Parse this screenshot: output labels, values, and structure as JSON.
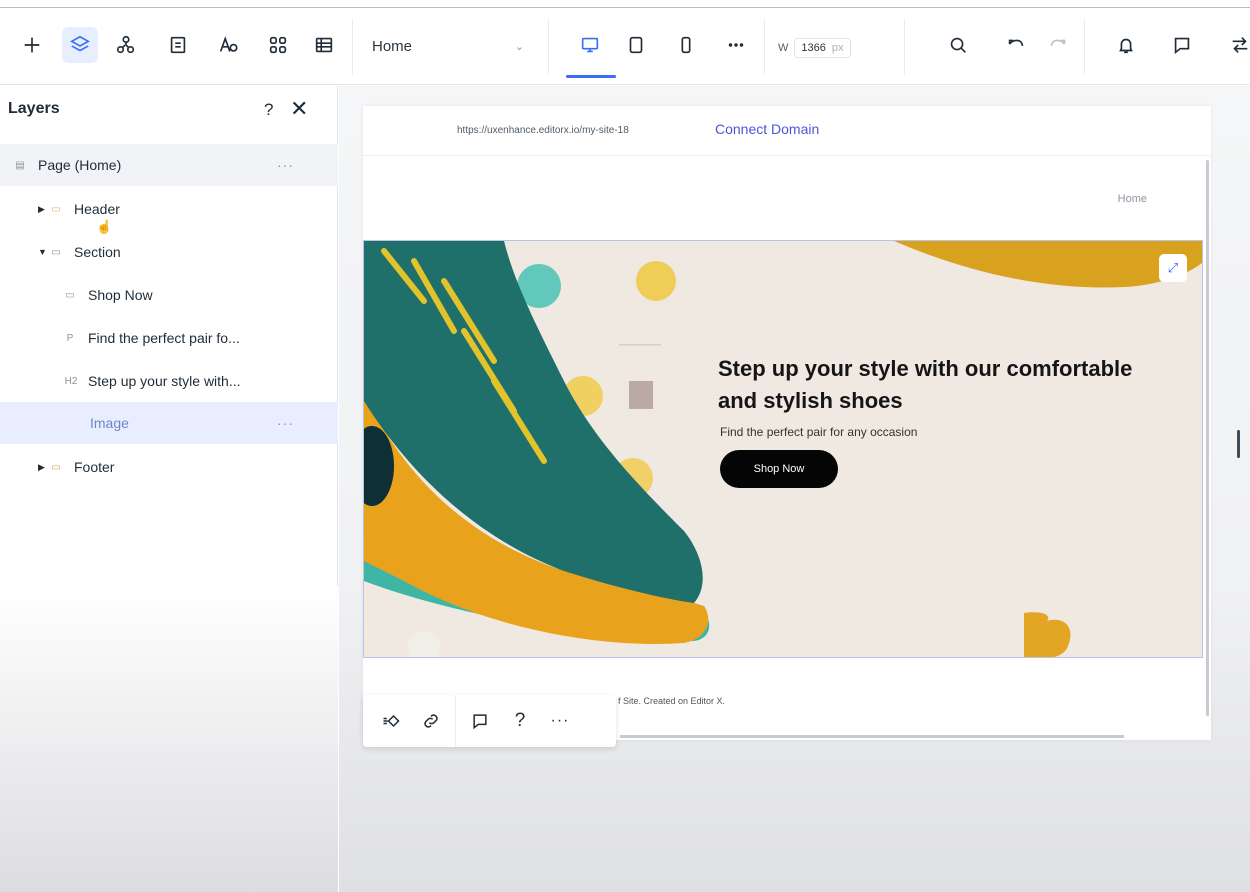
{
  "toolbar": {
    "page_select": "Home",
    "width_label": "W",
    "width_value": "1366",
    "width_unit": "px"
  },
  "layers": {
    "title": "Layers",
    "help": "?",
    "close": "✕",
    "items": [
      {
        "label": "Page (Home)",
        "icon": "page-icon"
      },
      {
        "label": "Header",
        "icon": "header-icon"
      },
      {
        "label": "Section",
        "icon": "section-icon"
      },
      {
        "label": "Shop Now",
        "icon": "button-icon"
      },
      {
        "label": "Find the perfect pair fo...",
        "prefix": "P"
      },
      {
        "label": "Step up your style with...",
        "prefix": "H2"
      },
      {
        "label": "Image",
        "icon": "image-icon"
      },
      {
        "label": "Footer",
        "icon": "footer-icon"
      }
    ]
  },
  "site": {
    "url": "https://uxenhance.editorx.io/my-site-18",
    "connect_domain": "Connect Domain",
    "nav_home": "Home",
    "hero_headline": "Step up your style with our comfortable and stylish shoes",
    "hero_sub": "Find the perfect pair for any occasion",
    "hero_button": "Shop Now",
    "footer_text": "f Site. Created on Editor X."
  },
  "float_toolbar": {
    "help": "?",
    "more": "···"
  },
  "colors": {
    "accent": "#3a6cf4",
    "connect": "#4b56d6",
    "shoe_teal": "#1f6f6a",
    "shoe_orange": "#e9a21b"
  }
}
